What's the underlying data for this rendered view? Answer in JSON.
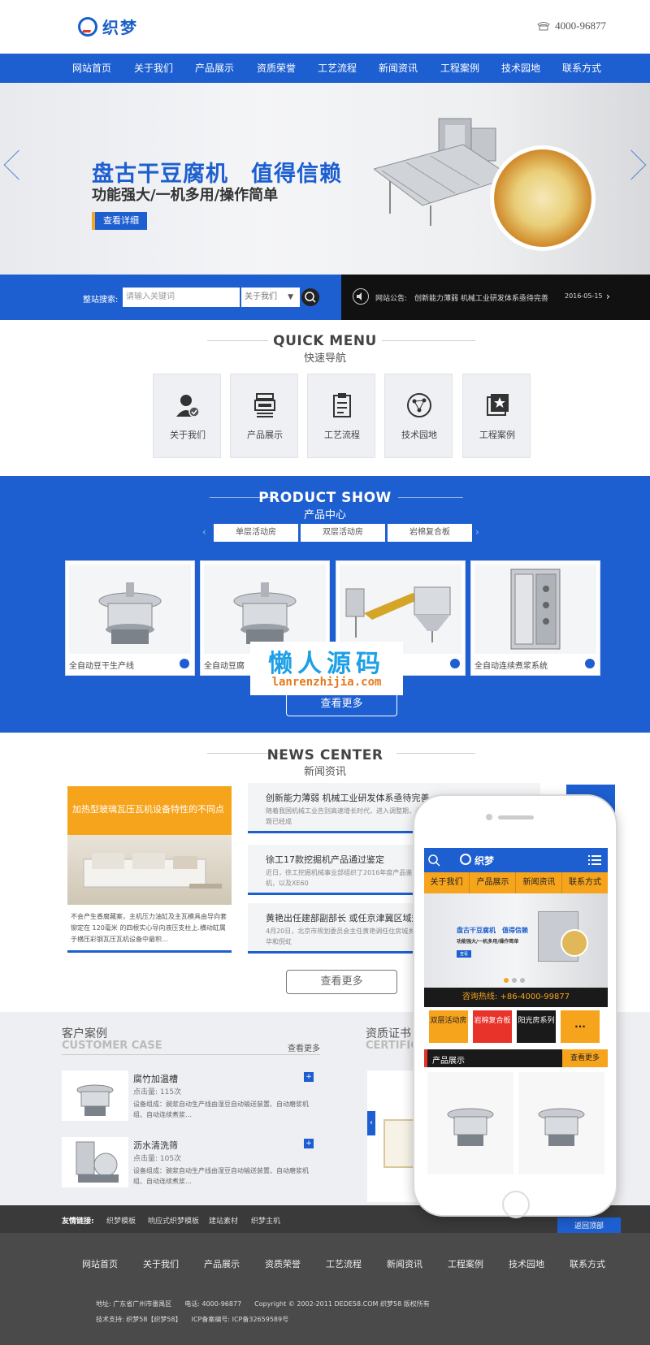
{
  "header": {
    "logo_text": "织梦",
    "phone": "4000-96877"
  },
  "nav": [
    "网站首页",
    "关于我们",
    "产品展示",
    "资质荣誉",
    "工艺流程",
    "新闻资讯",
    "工程案例",
    "技术园地",
    "联系方式"
  ],
  "banner": {
    "title": "盘古干豆腐机　值得信赖",
    "subtitle": "功能强大/一机多用/操作简单",
    "button": "查看详细"
  },
  "search": {
    "label": "整站搜索:",
    "placeholder": "请输入关键词",
    "select": "关于我们"
  },
  "notice": {
    "label": "网站公告:",
    "text": "创新能力薄弱 机械工业研发体系亟待完善",
    "date": "2016-05-15"
  },
  "quick_menu": {
    "title": "QUICK MENU",
    "subtitle": "快速导航",
    "items": [
      "关于我们",
      "产品展示",
      "工艺流程",
      "技术园地",
      "工程案例"
    ]
  },
  "products": {
    "title": "PRODUCT SHOW",
    "subtitle": "产品中心",
    "tabs": [
      "单层活动房",
      "双层活动房",
      "岩棉复合板"
    ],
    "items": [
      "全自动豆干生产线",
      "全自动豆腐",
      "",
      "全自动连续煮浆系统"
    ],
    "more": "查看更多"
  },
  "watermark": {
    "main": "懒人源码",
    "sub": "lanrenzhijia.com"
  },
  "news": {
    "title": "NEWS CENTER",
    "subtitle": "新闻资讯",
    "featured_title": "加热型玻璃瓦压瓦机设备特性的不同点",
    "featured_text": "不会产生香腐藏案，主机压力油缸及主瓦模具由导向套铆定在 120毫米 的四根实心导向液压支柱上.横动缸属于横压彩钢瓦压瓦机设备中最积…",
    "items": [
      {
        "title": "创新能力薄弱 机械工业研发体系亟待完善",
        "text": "随着我国机械工业告别高速增长时代，进入调整期，凸显，创新能力薄弱、产业结构失衡等问题已经成"
      },
      {
        "title": "徐工17款挖掘机产品通过鉴定",
        "text": "近日，徐工挖掘机械事业部组织了2016年度产品鉴定款全新研发的50系列履带式液压挖掘机，以及XE60"
      },
      {
        "title": "黄艳出任建部副部长 或任京津冀区域规划",
        "text": "4月20日，北京市规划委员会主任黄艳调任住房城乡规划，据时，住建部副部长由易军，陆克华和倪虹"
      }
    ],
    "more": "查看更多"
  },
  "cases": {
    "title": "客户案例",
    "title_en": "CUSTOMER CASE",
    "more": "查看更多",
    "items": [
      {
        "title": "腐竹加温槽",
        "clicks": "点击量: 115次",
        "desc": "设备组成：豌浆自动生产线由湿豆自动输送装置、自动磨浆机组、自动连续煮浆…"
      },
      {
        "title": "沥水清洗筛",
        "clicks": "点击量: 105次",
        "desc": "设备组成：豌浆自动生产线由湿豆自动输送装置、自动磨浆机组、自动连续煮浆…"
      }
    ],
    "cert_title": "资质证书",
    "cert_en": "CERTIFICATE"
  },
  "links": {
    "label": "友情链接:",
    "items": [
      "织梦模板",
      "响应式织梦模板",
      "建站素材",
      "织梦主机"
    ],
    "back_top": "返回顶部"
  },
  "footer": {
    "nav": [
      "网站首页",
      "关于我们",
      "产品展示",
      "资质荣誉",
      "工艺流程",
      "新闻资讯",
      "工程案例",
      "技术园地",
      "联系方式"
    ],
    "line1": "地址: 广东省广州市番禺区　　电话: 4000-96877　　Copyright © 2002-2011 DEDE58.COM 织梦58 版权所有",
    "line2": "技术支持: 织梦58【织梦58】　　ICP备案编号: ICP备32659589号"
  },
  "mobile": {
    "logo": "织梦",
    "nav": [
      "关于我们",
      "产品展示",
      "新闻资讯",
      "联系方式"
    ],
    "banner_title": "盘古干豆腐机　值得信赖",
    "banner_sub": "功能强大/一机多用/操作简单",
    "banner_btn": "查看",
    "hotline": "咨询热线: +86-4000-99877",
    "cats": [
      "双层活动房",
      "岩棉复合板",
      "阳光房系列",
      "..."
    ],
    "prod_title": "产品展示",
    "prod_more": "查看更多"
  },
  "colors": {
    "brand_blue": "#1d5fd0",
    "accent_orange": "#f7a41d",
    "dark": "#111111"
  }
}
